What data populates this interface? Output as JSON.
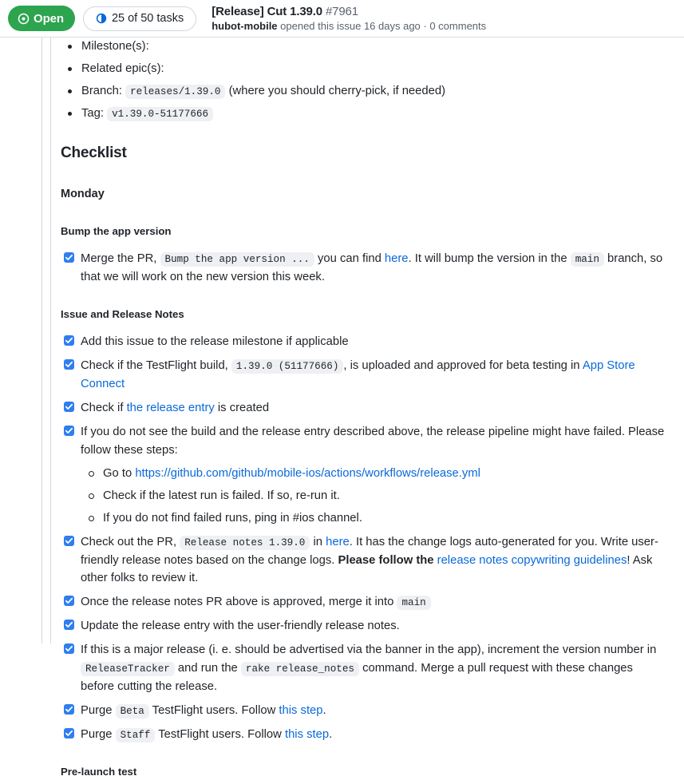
{
  "header": {
    "state_badge": {
      "label": "Open",
      "icon": "issue-open-icon",
      "color": "#2da44e"
    },
    "tasks_pill": {
      "label": "25 of 50 tasks",
      "icon": "task-progress-icon",
      "completed": 25,
      "total": 50,
      "color": "#0969da"
    },
    "title": "[Release] Cut 1.39.0",
    "issue_number": "#7961",
    "author": "hubot-mobile",
    "meta_text": " opened this issue 16 days ago · 0 comments"
  },
  "body": {
    "top_list": [
      {
        "prefix": "Milestone(s):",
        "code": "",
        "suffix": ""
      },
      {
        "prefix": "Related epic(s):",
        "code": "",
        "suffix": ""
      },
      {
        "prefix": "Branch: ",
        "code": "releases/1.39.0",
        "suffix": " (where you should cherry-pick, if needed)"
      },
      {
        "prefix": "Tag: ",
        "code": "v1.39.0-51177666",
        "suffix": ""
      }
    ],
    "checklist_heading": "Checklist",
    "monday_heading": "Monday",
    "bump_heading": "Bump the app version",
    "bump_task": {
      "t1": "Merge the PR, ",
      "code1": "Bump the app version ...",
      "t2": " you can find ",
      "link1": "here",
      "t3": ". It will bump the version in the ",
      "code2": "main",
      "t4": " branch, so that we will work on the new version this week."
    },
    "notes_heading": "Issue and Release Notes",
    "task_milestone": "Add this issue to the release milestone if applicable",
    "task_testflight": {
      "t1": "Check if the TestFlight build, ",
      "code1": "1.39.0 (51177666)",
      "t2": ", is uploaded and approved for beta testing in ",
      "link1": "App Store Connect"
    },
    "task_release_entry": {
      "t1": "Check if ",
      "link1": "the release entry",
      "t2": " is created"
    },
    "task_pipeline": {
      "t1": "If you do not see the build and the release entry described above, the release pipeline might have failed. Please follow these steps:",
      "sub": [
        {
          "t1": "Go to ",
          "link1": "https://github.com/github/mobile-ios/actions/workflows/release.yml",
          "t2": ""
        },
        {
          "t1": "Check if the latest run is failed. If so, re-run it.",
          "link1": "",
          "t2": ""
        },
        {
          "t1": "If you do not find failed runs, ping in #ios channel.",
          "link1": "",
          "t2": ""
        }
      ]
    },
    "task_changelog": {
      "t1": "Check out the PR, ",
      "code1": "Release notes 1.39.0",
      "t2": " in ",
      "link1": "here",
      "t3": ". It has the change logs auto-generated for you. Write user-friendly release notes based on the change logs. ",
      "bold1": "Please follow the ",
      "link2": "release notes copywriting guidelines",
      "t4": "! Ask other folks to review it."
    },
    "task_merge_main": {
      "t1": "Once the release notes PR above is approved, merge it into ",
      "code1": "main"
    },
    "task_update_entry": "Update the release entry with the user-friendly release notes.",
    "task_major_release": {
      "t1": "If this is a major release (i. e. should be advertised via the banner in the app), increment the version number in ",
      "code1": "ReleaseTracker",
      "t2": " and run the ",
      "code2": "rake release_notes",
      "t3": " command. Merge a pull request with these changes before cutting the release."
    },
    "task_purge_beta": {
      "t1": "Purge ",
      "code1": "Beta",
      "t2": " TestFlight users. Follow ",
      "link1": "this step",
      "t3": "."
    },
    "task_purge_staff": {
      "t1": "Purge ",
      "code1": "Staff",
      "t2": " TestFlight users. Follow ",
      "link1": "this step",
      "t3": "."
    },
    "prelaunch_heading": "Pre-launch test"
  }
}
